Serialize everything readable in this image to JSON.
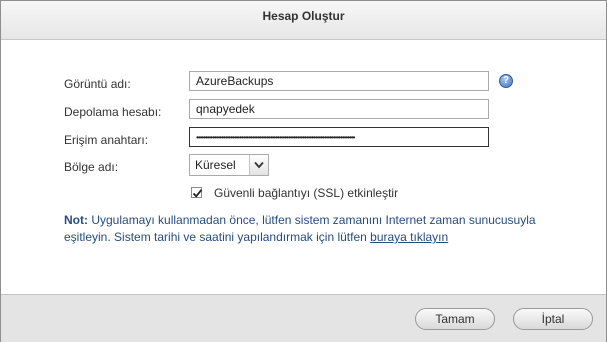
{
  "dialog": {
    "title": "Hesap Oluştur"
  },
  "form": {
    "display_name_label": "Görüntü adı:",
    "display_name_value": "AzureBackups",
    "storage_account_label": "Depolama hesabı:",
    "storage_account_value": "qnapyedek",
    "access_key_label": "Erişim anahtarı:",
    "access_key_value": "••••••••••••••••••••••••••••••••••••••••••••••••••••••••••••••••••••••••••••••••••••••••",
    "region_label": "Bölge adı:",
    "region_value": "Küresel",
    "ssl_checked": true,
    "ssl_label": "Güvenli bağlantıyı (SSL) etkinleştir",
    "help_icon": "help-icon"
  },
  "note": {
    "prefix": "Not:",
    "text": " Uygulamayı kullanmadan önce, lütfen sistem zamanını Internet zaman sunucusuyla eşitleyin. Sistem tarihi ve saatini yapılandırmak için lütfen ",
    "link": "buraya tıklayın"
  },
  "footer": {
    "ok_label": "Tamam",
    "cancel_label": "İptal"
  }
}
